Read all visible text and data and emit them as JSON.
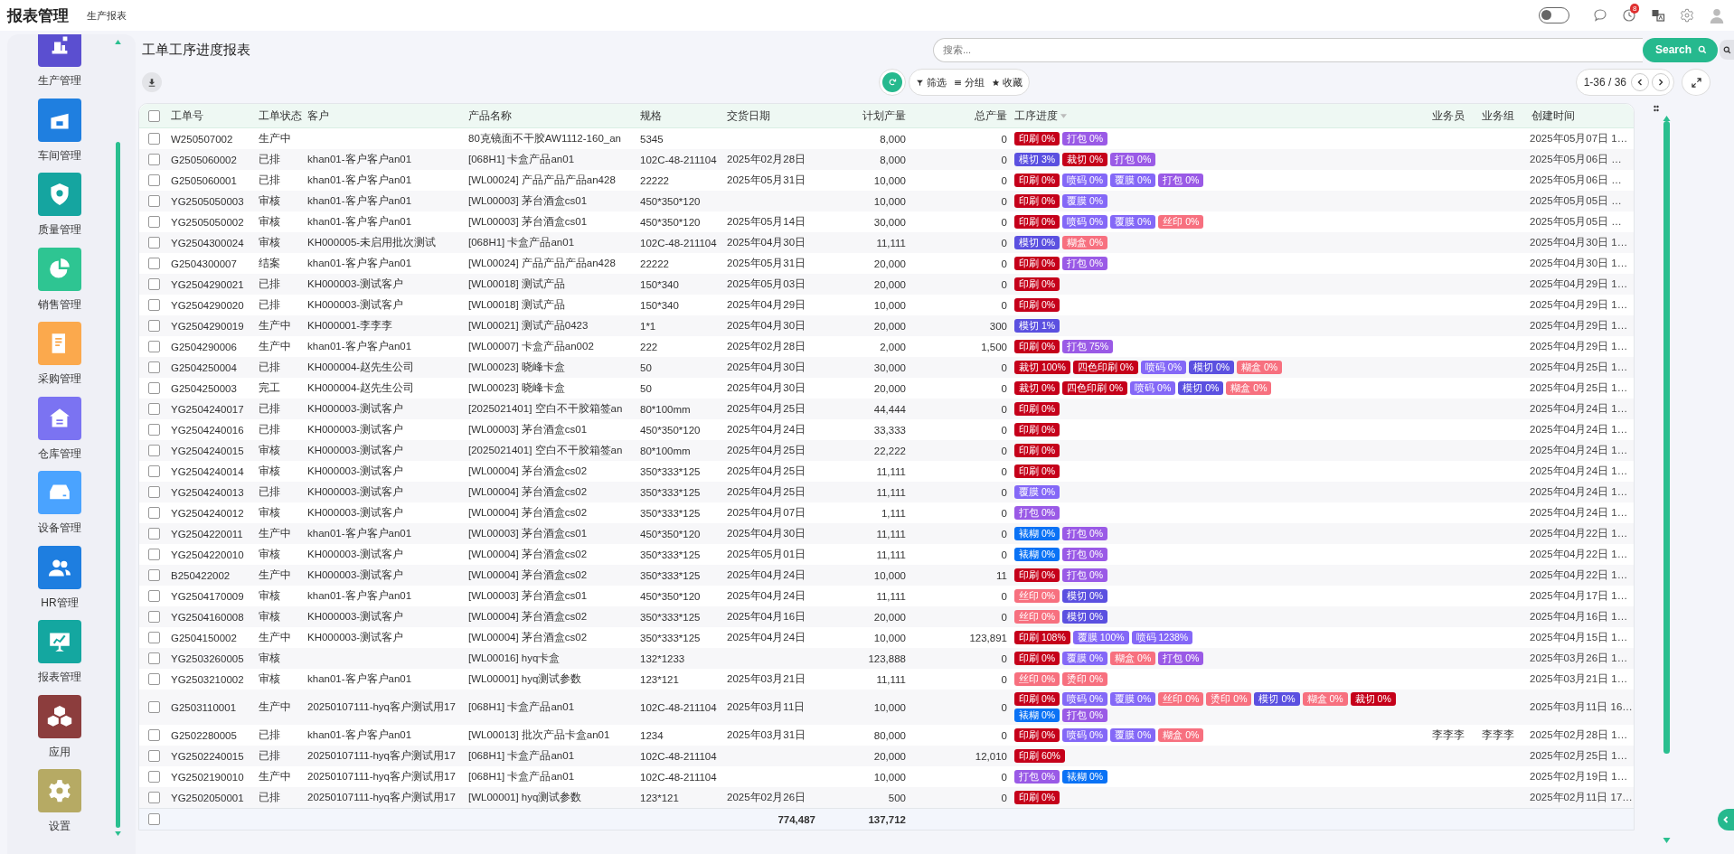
{
  "header": {
    "app_title": "报表管理",
    "nav_item": "生产报表",
    "theme_toggle": {
      "on": false
    },
    "notification_count": "8"
  },
  "sidebar": {
    "items": [
      {
        "label": "生产管理",
        "color": "#5b4fd0",
        "selected": false
      },
      {
        "label": "车间管理",
        "color": "#1f7fe0",
        "selected": false
      },
      {
        "label": "质量管理",
        "color": "#15a5a0",
        "selected": false
      },
      {
        "label": "销售管理",
        "color": "#2ec592",
        "selected": false
      },
      {
        "label": "采购管理",
        "color": "#fba94d",
        "selected": false
      },
      {
        "label": "仓库管理",
        "color": "#7b73f2",
        "selected": false
      },
      {
        "label": "设备管理",
        "color": "#4aa3ff",
        "selected": false
      },
      {
        "label": "HR管理",
        "color": "#1e7ee0",
        "selected": false
      },
      {
        "label": "报表管理",
        "color": "#14a7a0",
        "selected": false
      },
      {
        "label": "应用",
        "color": "#8c3d3d",
        "selected": false
      },
      {
        "label": "设置",
        "color": "#b6aa64",
        "selected": false
      }
    ]
  },
  "page": {
    "title": "工单工序进度报表",
    "search": {
      "placeholder": "搜索..."
    },
    "search_button": "Search",
    "filters": [
      "筛选",
      "分组",
      "收藏"
    ],
    "pager": "1-36 / 36"
  },
  "table": {
    "select_all": {
      "checked": false
    },
    "columns": [
      "工单号",
      "工单状态",
      "客户",
      "产品名称",
      "规格",
      "交货日期",
      "计划产量",
      "总产量",
      "工序进度",
      "业务员",
      "业务组",
      "创建时间"
    ],
    "rows": [
      {
        "checked": false,
        "order_no": "W250507002",
        "status": "生产中",
        "customer": "",
        "product": "80克镜面不干胶AW1112-160_an",
        "spec": "5345",
        "delivery": "",
        "planned": "8,000",
        "total": "0",
        "progress": [
          {
            "label": "印刷 0%",
            "color": "#c5001a"
          },
          {
            "label": "打包 0%",
            "color": "#9a5ae6"
          }
        ],
        "salesperson": "",
        "group": "",
        "created": "2025年05月07日 1…"
      },
      {
        "checked": false,
        "order_no": "G2505060002",
        "status": "已排",
        "customer": "khan01-客户客户an01",
        "product": "[068H1] 卡盒产品an01",
        "spec": "102C-48-211104",
        "delivery": "2025年02月28日",
        "planned": "8,000",
        "total": "0",
        "progress": [
          {
            "label": "模切 3%",
            "color": "#5b50e0"
          },
          {
            "label": "裁切 0%",
            "color": "#c5001a"
          },
          {
            "label": "打包 0%",
            "color": "#9a5ae6"
          }
        ],
        "salesperson": "",
        "group": "",
        "created": "2025年05月06日 …"
      },
      {
        "checked": false,
        "order_no": "G2505060001",
        "status": "已排",
        "customer": "khan01-客户客户an01",
        "product": "[WL00024] 产品产品产品an428",
        "spec": "22222",
        "delivery": "2025年05月31日",
        "planned": "10,000",
        "total": "0",
        "progress": [
          {
            "label": "印刷 0%",
            "color": "#c5001a"
          },
          {
            "label": "喷码 0%",
            "color": "#8468f7"
          },
          {
            "label": "覆膜 0%",
            "color": "#8468f7"
          },
          {
            "label": "打包 0%",
            "color": "#9a5ae6"
          }
        ],
        "salesperson": "",
        "group": "",
        "created": "2025年05月06日 …"
      },
      {
        "checked": false,
        "order_no": "YG2505050003",
        "status": "审核",
        "customer": "khan01-客户客户an01",
        "product": "[WL00003] 茅台酒盒cs01",
        "spec": "450*350*120",
        "delivery": "",
        "planned": "10,000",
        "total": "0",
        "progress": [
          {
            "label": "印刷 0%",
            "color": "#c5001a"
          },
          {
            "label": "覆膜 0%",
            "color": "#8468f7"
          }
        ],
        "salesperson": "",
        "group": "",
        "created": "2025年05月05日 …"
      },
      {
        "checked": false,
        "order_no": "YG2505050002",
        "status": "审核",
        "customer": "khan01-客户客户an01",
        "product": "[WL00003] 茅台酒盒cs01",
        "spec": "450*350*120",
        "delivery": "2025年05月14日",
        "planned": "30,000",
        "total": "0",
        "progress": [
          {
            "label": "印刷 0%",
            "color": "#c5001a"
          },
          {
            "label": "喷码 0%",
            "color": "#8468f7"
          },
          {
            "label": "覆膜 0%",
            "color": "#8468f7"
          },
          {
            "label": "丝印 0%",
            "color": "#f7707f"
          }
        ],
        "salesperson": "",
        "group": "",
        "created": "2025年05月05日 …"
      },
      {
        "checked": false,
        "order_no": "YG2504300024",
        "status": "审核",
        "customer": "KH000005-未启用批次测试",
        "product": "[068H1] 卡盒产品an01",
        "spec": "102C-48-211104",
        "delivery": "2025年04月30日",
        "planned": "11,111",
        "total": "0",
        "progress": [
          {
            "label": "模切 0%",
            "color": "#5b50e0"
          },
          {
            "label": "糊盒 0%",
            "color": "#f7707f"
          }
        ],
        "salesperson": "",
        "group": "",
        "created": "2025年04月30日 1…"
      },
      {
        "checked": false,
        "order_no": "G2504300007",
        "status": "结案",
        "customer": "khan01-客户客户an01",
        "product": "[WL00024] 产品产品产品an428",
        "spec": "22222",
        "delivery": "2025年05月31日",
        "planned": "20,000",
        "total": "0",
        "progress": [
          {
            "label": "印刷 0%",
            "color": "#c5001a"
          },
          {
            "label": "打包 0%",
            "color": "#9a5ae6"
          }
        ],
        "salesperson": "",
        "group": "",
        "created": "2025年04月30日 1…"
      },
      {
        "checked": false,
        "order_no": "YG2504290021",
        "status": "已排",
        "customer": "KH000003-测试客户",
        "product": "[WL00018] 测试产品",
        "spec": "150*340",
        "delivery": "2025年05月03日",
        "planned": "20,000",
        "total": "0",
        "progress": [
          {
            "label": "印刷 0%",
            "color": "#c5001a"
          }
        ],
        "salesperson": "",
        "group": "",
        "created": "2025年04月29日 1…"
      },
      {
        "checked": false,
        "order_no": "YG2504290020",
        "status": "已排",
        "customer": "KH000003-测试客户",
        "product": "[WL00018] 测试产品",
        "spec": "150*340",
        "delivery": "2025年04月29日",
        "planned": "10,000",
        "total": "0",
        "progress": [
          {
            "label": "印刷 0%",
            "color": "#c5001a"
          }
        ],
        "salesperson": "",
        "group": "",
        "created": "2025年04月29日 1…"
      },
      {
        "checked": false,
        "order_no": "YG2504290019",
        "status": "生产中",
        "customer": "KH000001-李李李",
        "product": "[WL00021] 测试产品0423",
        "spec": "1*1",
        "delivery": "2025年04月30日",
        "planned": "20,000",
        "total": "300",
        "progress": [
          {
            "label": "模切 1%",
            "color": "#5b50e0"
          }
        ],
        "salesperson": "",
        "group": "",
        "created": "2025年04月29日 1…"
      },
      {
        "checked": false,
        "order_no": "G2504290006",
        "status": "生产中",
        "customer": "khan01-客户客户an01",
        "product": "[WL00007] 卡盒产品an002",
        "spec": "222",
        "delivery": "2025年02月28日",
        "planned": "2,000",
        "total": "1,500",
        "progress": [
          {
            "label": "印刷 0%",
            "color": "#c5001a"
          },
          {
            "label": "打包 75%",
            "color": "#9a5ae6"
          }
        ],
        "salesperson": "",
        "group": "",
        "created": "2025年04月29日 1…"
      },
      {
        "checked": false,
        "order_no": "G2504250004",
        "status": "已排",
        "customer": "KH000004-赵先生公司",
        "product": "[WL00023] 晓峰卡盒",
        "spec": "50",
        "delivery": "2025年04月30日",
        "planned": "30,000",
        "total": "0",
        "progress": [
          {
            "label": "裁切 100%",
            "color": "#c5001a"
          },
          {
            "label": "四色印刷 0%",
            "color": "#c5001a"
          },
          {
            "label": "喷码 0%",
            "color": "#8468f7"
          },
          {
            "label": "模切 0%",
            "color": "#5b50e0"
          },
          {
            "label": "糊盒 0%",
            "color": "#f7707f"
          }
        ],
        "salesperson": "",
        "group": "",
        "created": "2025年04月25日 1…"
      },
      {
        "checked": false,
        "order_no": "G2504250003",
        "status": "完工",
        "customer": "KH000004-赵先生公司",
        "product": "[WL00023] 晓峰卡盒",
        "spec": "50",
        "delivery": "2025年04月30日",
        "planned": "20,000",
        "total": "0",
        "progress": [
          {
            "label": "裁切 0%",
            "color": "#c5001a"
          },
          {
            "label": "四色印刷 0%",
            "color": "#c5001a"
          },
          {
            "label": "喷码 0%",
            "color": "#8468f7"
          },
          {
            "label": "模切 0%",
            "color": "#5b50e0"
          },
          {
            "label": "糊盒 0%",
            "color": "#f7707f"
          }
        ],
        "salesperson": "",
        "group": "",
        "created": "2025年04月25日 1…"
      },
      {
        "checked": false,
        "order_no": "YG2504240017",
        "status": "已排",
        "customer": "KH000003-测试客户",
        "product": "[2025021401] 空白不干胶箱签an",
        "spec": "80*100mm",
        "delivery": "2025年04月25日",
        "planned": "44,444",
        "total": "0",
        "progress": [
          {
            "label": "印刷 0%",
            "color": "#c5001a"
          }
        ],
        "salesperson": "",
        "group": "",
        "created": "2025年04月24日 1…"
      },
      {
        "checked": false,
        "order_no": "YG2504240016",
        "status": "已排",
        "customer": "KH000003-测试客户",
        "product": "[WL00003] 茅台酒盒cs01",
        "spec": "450*350*120",
        "delivery": "2025年04月24日",
        "planned": "33,333",
        "total": "0",
        "progress": [
          {
            "label": "印刷 0%",
            "color": "#c5001a"
          }
        ],
        "salesperson": "",
        "group": "",
        "created": "2025年04月24日 1…"
      },
      {
        "checked": false,
        "order_no": "YG2504240015",
        "status": "审核",
        "customer": "KH000003-测试客户",
        "product": "[2025021401] 空白不干胶箱签an",
        "spec": "80*100mm",
        "delivery": "2025年04月25日",
        "planned": "22,222",
        "total": "0",
        "progress": [
          {
            "label": "印刷 0%",
            "color": "#c5001a"
          }
        ],
        "salesperson": "",
        "group": "",
        "created": "2025年04月24日 1…"
      },
      {
        "checked": false,
        "order_no": "YG2504240014",
        "status": "审核",
        "customer": "KH000003-测试客户",
        "product": "[WL00004] 茅台酒盒cs02",
        "spec": "350*333*125",
        "delivery": "2025年04月25日",
        "planned": "11,111",
        "total": "0",
        "progress": [
          {
            "label": "印刷 0%",
            "color": "#c5001a"
          }
        ],
        "salesperson": "",
        "group": "",
        "created": "2025年04月24日 1…"
      },
      {
        "checked": false,
        "order_no": "YG2504240013",
        "status": "已排",
        "customer": "KH000003-测试客户",
        "product": "[WL00004] 茅台酒盒cs02",
        "spec": "350*333*125",
        "delivery": "2025年04月25日",
        "planned": "11,111",
        "total": "0",
        "progress": [
          {
            "label": "覆膜 0%",
            "color": "#8468f7"
          }
        ],
        "salesperson": "",
        "group": "",
        "created": "2025年04月24日 1…"
      },
      {
        "checked": false,
        "order_no": "YG2504240012",
        "status": "审核",
        "customer": "KH000003-测试客户",
        "product": "[WL00004] 茅台酒盒cs02",
        "spec": "350*333*125",
        "delivery": "2025年04月07日",
        "planned": "1,111",
        "total": "0",
        "progress": [
          {
            "label": "打包 0%",
            "color": "#9a5ae6"
          }
        ],
        "salesperson": "",
        "group": "",
        "created": "2025年04月24日 1…"
      },
      {
        "checked": false,
        "order_no": "YG2504220011",
        "status": "生产中",
        "customer": "khan01-客户客户an01",
        "product": "[WL00003] 茅台酒盒cs01",
        "spec": "450*350*120",
        "delivery": "2025年04月30日",
        "planned": "11,111",
        "total": "0",
        "progress": [
          {
            "label": "裱糊 0%",
            "color": "#0a72f5"
          },
          {
            "label": "打包 0%",
            "color": "#9a5ae6"
          }
        ],
        "salesperson": "",
        "group": "",
        "created": "2025年04月22日 1…"
      },
      {
        "checked": false,
        "order_no": "YG2504220010",
        "status": "审核",
        "customer": "KH000003-测试客户",
        "product": "[WL00004] 茅台酒盒cs02",
        "spec": "350*333*125",
        "delivery": "2025年05月01日",
        "planned": "11,111",
        "total": "0",
        "progress": [
          {
            "label": "裱糊 0%",
            "color": "#0a72f5"
          },
          {
            "label": "打包 0%",
            "color": "#9a5ae6"
          }
        ],
        "salesperson": "",
        "group": "",
        "created": "2025年04月22日 1…"
      },
      {
        "checked": false,
        "order_no": "B250422002",
        "status": "生产中",
        "customer": "KH000003-测试客户",
        "product": "[WL00004] 茅台酒盒cs02",
        "spec": "350*333*125",
        "delivery": "2025年04月24日",
        "planned": "10,000",
        "total": "11",
        "progress": [
          {
            "label": "印刷 0%",
            "color": "#c5001a"
          },
          {
            "label": "打包 0%",
            "color": "#9a5ae6"
          }
        ],
        "salesperson": "",
        "group": "",
        "created": "2025年04月22日 1…"
      },
      {
        "checked": false,
        "order_no": "YG2504170009",
        "status": "审核",
        "customer": "khan01-客户客户an01",
        "product": "[WL00003] 茅台酒盒cs01",
        "spec": "450*350*120",
        "delivery": "2025年04月24日",
        "planned": "11,111",
        "total": "0",
        "progress": [
          {
            "label": "丝印 0%",
            "color": "#f7707f"
          },
          {
            "label": "模切 0%",
            "color": "#5b50e0"
          }
        ],
        "salesperson": "",
        "group": "",
        "created": "2025年04月17日 1…"
      },
      {
        "checked": false,
        "order_no": "YG2504160008",
        "status": "审核",
        "customer": "KH000003-测试客户",
        "product": "[WL00004] 茅台酒盒cs02",
        "spec": "350*333*125",
        "delivery": "2025年04月16日",
        "planned": "20,000",
        "total": "0",
        "progress": [
          {
            "label": "丝印 0%",
            "color": "#f7707f"
          },
          {
            "label": "模切 0%",
            "color": "#5b50e0"
          }
        ],
        "salesperson": "",
        "group": "",
        "created": "2025年04月16日 1…"
      },
      {
        "checked": false,
        "order_no": "G2504150002",
        "status": "生产中",
        "customer": "KH000003-测试客户",
        "product": "[WL00004] 茅台酒盒cs02",
        "spec": "350*333*125",
        "delivery": "2025年04月24日",
        "planned": "10,000",
        "total": "123,891",
        "progress": [
          {
            "label": "印刷 108%",
            "color": "#c5001a"
          },
          {
            "label": "覆膜 100%",
            "color": "#8468f7"
          },
          {
            "label": "喷码 1238%",
            "color": "#8468f7"
          }
        ],
        "salesperson": "",
        "group": "",
        "created": "2025年04月15日 1…"
      },
      {
        "checked": false,
        "order_no": "YG2503260005",
        "status": "审核",
        "customer": "",
        "product": "[WL00016] hyq卡盒",
        "spec": "132*1233",
        "delivery": "",
        "planned": "123,888",
        "total": "0",
        "progress": [
          {
            "label": "印刷 0%",
            "color": "#c5001a"
          },
          {
            "label": "覆膜 0%",
            "color": "#8468f7"
          },
          {
            "label": "糊盒 0%",
            "color": "#f7707f"
          },
          {
            "label": "打包 0%",
            "color": "#9a5ae6"
          }
        ],
        "salesperson": "",
        "group": "",
        "created": "2025年03月26日 1…"
      },
      {
        "checked": false,
        "order_no": "YG2503210002",
        "status": "审核",
        "customer": "khan01-客户客户an01",
        "product": "[WL00001] hyq测试参数",
        "spec": "123*121",
        "delivery": "2025年03月21日",
        "planned": "11,111",
        "total": "0",
        "progress": [
          {
            "label": "丝印 0%",
            "color": "#f7707f"
          },
          {
            "label": "烫印 0%",
            "color": "#f7707f"
          }
        ],
        "salesperson": "",
        "group": "",
        "created": "2025年03月21日 1…"
      },
      {
        "checked": false,
        "order_no": "G2503110001",
        "status": "生产中",
        "customer": "20250107111-hyq客户测试用17",
        "product": "[068H1] 卡盒产品an01",
        "spec": "102C-48-211104",
        "delivery": "2025年03月11日",
        "planned": "10,000",
        "total": "0",
        "progress": [
          {
            "label": "印刷 0%",
            "color": "#c5001a"
          },
          {
            "label": "喷码 0%",
            "color": "#8468f7"
          },
          {
            "label": "覆膜 0%",
            "color": "#8468f7"
          },
          {
            "label": "丝印 0%",
            "color": "#f7707f"
          },
          {
            "label": "烫印 0%",
            "color": "#f7707f"
          },
          {
            "label": "模切 0%",
            "color": "#5b50e0"
          },
          {
            "label": "糊盒 0%",
            "color": "#f7707f"
          },
          {
            "label": "裁切 0%",
            "color": "#c5001a"
          },
          {
            "label": "裱糊 0%",
            "color": "#0a72f5"
          },
          {
            "label": "打包 0%",
            "color": "#9a5ae6"
          }
        ],
        "salesperson": "",
        "group": "",
        "created": "2025年03月11日 16…"
      },
      {
        "checked": false,
        "order_no": "G2502280005",
        "status": "已排",
        "customer": "khan01-客户客户an01",
        "product": "[WL00013] 批次产品卡盒an01",
        "spec": "1234",
        "delivery": "2025年03月31日",
        "planned": "80,000",
        "total": "0",
        "progress": [
          {
            "label": "印刷 0%",
            "color": "#c5001a"
          },
          {
            "label": "喷码 0%",
            "color": "#8468f7"
          },
          {
            "label": "覆膜 0%",
            "color": "#8468f7"
          },
          {
            "label": "糊盒 0%",
            "color": "#f7707f"
          }
        ],
        "salesperson": "李李李",
        "group": "李李李",
        "created": "2025年02月28日 1…"
      },
      {
        "checked": false,
        "order_no": "YG2502240015",
        "status": "已排",
        "customer": "20250107111-hyq客户测试用17",
        "product": "[068H1] 卡盒产品an01",
        "spec": "102C-48-211104",
        "delivery": "",
        "planned": "20,000",
        "total": "12,010",
        "progress": [
          {
            "label": "印刷 60%",
            "color": "#c5001a"
          }
        ],
        "salesperson": "",
        "group": "",
        "created": "2025年02月25日 1…"
      },
      {
        "checked": false,
        "order_no": "YG2502190010",
        "status": "生产中",
        "customer": "20250107111-hyq客户测试用17",
        "product": "[068H1] 卡盒产品an01",
        "spec": "102C-48-211104",
        "delivery": "",
        "planned": "10,000",
        "total": "0",
        "progress": [
          {
            "label": "打包 0%",
            "color": "#9a5ae6"
          },
          {
            "label": "裱糊 0%",
            "color": "#0a72f5"
          }
        ],
        "salesperson": "",
        "group": "",
        "created": "2025年02月19日 1…"
      },
      {
        "checked": false,
        "order_no": "YG2502050001",
        "status": "已排",
        "customer": "20250107111-hyq客户测试用17",
        "product": "[WL00001] hyq测试参数",
        "spec": "123*121",
        "delivery": "2025年02月26日",
        "planned": "500",
        "total": "0",
        "progress": [
          {
            "label": "印刷 0%",
            "color": "#c5001a"
          }
        ],
        "salesperson": "",
        "group": "",
        "created": "2025年02月11日 17…"
      }
    ],
    "totals": {
      "checked": false,
      "planned": "774,487",
      "total": "137,712"
    }
  }
}
